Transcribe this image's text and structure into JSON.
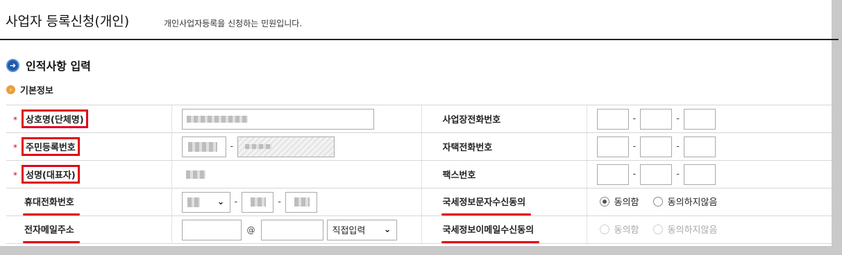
{
  "header": {
    "title": "사업자 등록신청(개인)",
    "description": "개인사업자등록을 신청하는 민원입니다."
  },
  "section": {
    "title": "인적사항 입력",
    "subtitle": "기본정보"
  },
  "form": {
    "required_mark": "*",
    "rows": [
      {
        "left_label": "상호명(단체명)",
        "right_label": "사업장전화번호"
      },
      {
        "left_label": "주민등록번호",
        "right_label": "자택전화번호"
      },
      {
        "left_label": "성명(대표자)",
        "right_label": "팩스번호"
      },
      {
        "left_label": "휴대전화번호",
        "right_label": "국세정보문자수신동의"
      },
      {
        "left_label": "전자메일주소",
        "right_label": "국세정보이메일수신동의"
      }
    ],
    "phone_dash": "-",
    "email_at": "@",
    "email_domain_select": "직접입력",
    "sms_consent": {
      "agree": "동의함",
      "disagree": "동의하지않음",
      "selected": "동의함"
    },
    "email_consent": {
      "agree": "동의함",
      "disagree": "동의하지않음",
      "selected": ""
    }
  },
  "colors": {
    "highlight": "#e2001a",
    "section_icon": "#1e5aa8",
    "subsection_icon": "#e9a03b"
  },
  "icons": {
    "section": "arrow-right-circle-icon",
    "subsection": "chevron-right-circle-icon",
    "select": "chevron-down-icon"
  }
}
